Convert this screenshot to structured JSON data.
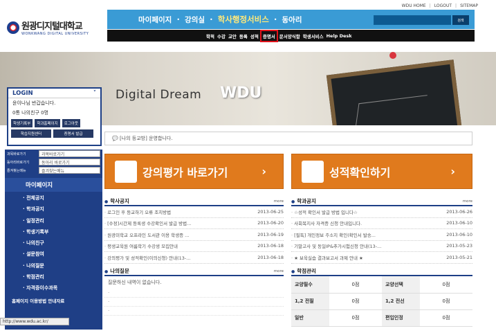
{
  "util": [
    "WDU HOME",
    "LOGOUT",
    "SITEMAP"
  ],
  "logo": {
    "kr": "원광디지털대학교",
    "en": "WONKWANG DIGITAL UNIVERSITY"
  },
  "gnb": {
    "items": [
      "마이페이지",
      "강의실",
      "학사행정서비스",
      "동아리"
    ],
    "search_button": "검색"
  },
  "subnav": [
    "학적",
    "수강",
    "교안",
    "등록",
    "성적",
    "증명서",
    "문서양식함",
    "학생서비스",
    "Help Desk"
  ],
  "hero": {
    "dream": "Digital Dream",
    "wdu": "WDU"
  },
  "login": {
    "title": "LOGIN",
    "greeting": "윤이나님 반갑습니다.",
    "stats": "0통  나의친구 0명",
    "buttons": [
      "학생기록부",
      "학과홈페이지",
      "로그아웃",
      "학습지원센터",
      "증명서 발급"
    ]
  },
  "notice": "[나의 등교방] 운영합니다.",
  "lnav": {
    "selects": [
      {
        "label": "과목바로가기",
        "value": "과목바로가기"
      },
      {
        "label": "동아리바로가기",
        "value": "동아리 바로가기"
      },
      {
        "label": "즐겨찾는메뉴",
        "value": "즐겨찾는메뉴"
      }
    ],
    "mypage": "마이페이지",
    "items": [
      "전체공지",
      "학과공지",
      "일정관리",
      "학생기록부",
      "나의친구",
      "설문참여",
      "나의질문",
      "학점관리",
      "자격증이수과목"
    ],
    "guide": "홈페이지 이용방법 안내자료"
  },
  "status": "http://www.wdu.ac.kr/",
  "bigbtns": [
    "강의평가 바로가기",
    "성적확인하기"
  ],
  "more": "more",
  "acad": {
    "title": "학사공지",
    "items": [
      {
        "t": "로그인 후 등교하기 오류 조치방법",
        "d": "2013-06-25"
      },
      {
        "t": "[수정]시간제 등록생 수강확인서 발급 방법...",
        "d": "2013-06-20"
      },
      {
        "t": "원광미학교 오프라인 도서관 이용 학생증 ...",
        "d": "2013-06-19"
      },
      {
        "t": "평생교육원 여름학기 수강생 모집안내",
        "d": "2013-06-18"
      },
      {
        "t": "강의평가 및 성적확인(이의신청) 안내(13-...",
        "d": "2013-06-18"
      }
    ]
  },
  "schoolnews": {
    "title": "학과공지",
    "items": [
      {
        "t": "☆성적 확인서 발급 방법 입니다☆",
        "d": "2013-06-26"
      },
      {
        "t": "사회복지사 자격증 신청 안내입니다.",
        "d": "2013-06-10"
      },
      {
        "t": "[필독] 개인정보 주소지 확인(확인서 발송...",
        "d": "2013-06-10"
      },
      {
        "t": "기말고사 및 동일IP&추가시험신청 안내(13-...",
        "d": "2013-05-23"
      },
      {
        "t": "★ 보육실습 결과보고서 과제 안내 ★",
        "d": "2013-05-21"
      }
    ]
  },
  "qna": {
    "title": "나의질문",
    "empty": "질문하신 내역이 없습니다."
  },
  "grade": {
    "title": "학점관리",
    "rows": [
      [
        "교양필수",
        "0점",
        "교양선택",
        "0점"
      ],
      [
        "1,2 전필",
        "0점",
        "1,2 전선",
        "0점"
      ],
      [
        "일반",
        "0점",
        "편입인정",
        "0점"
      ]
    ]
  }
}
